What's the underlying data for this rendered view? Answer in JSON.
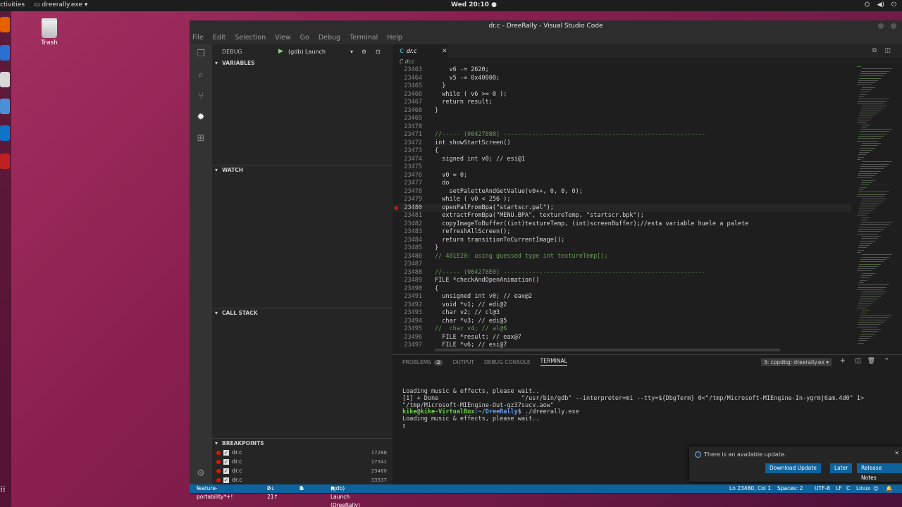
{
  "desktop": {
    "topbar": {
      "activities": "ctivities",
      "app_menu": "dreerally.exe",
      "clock": "Wed 20:10 ●"
    },
    "trash_label": "Trash"
  },
  "window": {
    "title": "dr.c - DreeRally - Visual Studio Code"
  },
  "menu": [
    "File",
    "Edit",
    "Selection",
    "View",
    "Go",
    "Debug",
    "Terminal",
    "Help"
  ],
  "debug": {
    "header": "DEBUG",
    "config": "(gdb) Launch",
    "sections": {
      "variables": "VARIABLES",
      "watch": "WATCH",
      "call_stack": "CALL STACK",
      "breakpoints": "BREAKPOINTS"
    },
    "breakpoints": [
      {
        "file": "dr.c",
        "line": "17288"
      },
      {
        "file": "dr.c",
        "line": "17341"
      },
      {
        "file": "dr.c",
        "line": "23480"
      },
      {
        "file": "dr.c",
        "line": "33537"
      }
    ]
  },
  "editor": {
    "tab": "dr.c",
    "tab_icon": "C",
    "breadcrumb": "C dr.c",
    "lines": [
      {
        "n": "23463",
        "t": "    v6 -= 2620;"
      },
      {
        "n": "23464",
        "t": "    v5 -= 0x40000;"
      },
      {
        "n": "23465",
        "t": "  }"
      },
      {
        "n": "23466",
        "t": "  while ( v6 >= 0 );"
      },
      {
        "n": "23467",
        "t": "  return result;"
      },
      {
        "n": "23468",
        "t": "}"
      },
      {
        "n": "23469",
        "t": ""
      },
      {
        "n": "23470",
        "t": ""
      },
      {
        "n": "23471",
        "t": "//----- (00427880) --------------------------------------------------------"
      },
      {
        "n": "23472",
        "t": "int showStartScreen()"
      },
      {
        "n": "23473",
        "t": "{"
      },
      {
        "n": "23474",
        "t": "  signed int v0; // esi@1"
      },
      {
        "n": "23475",
        "t": ""
      },
      {
        "n": "23476",
        "t": "  v0 = 0;"
      },
      {
        "n": "23477",
        "t": "  do"
      },
      {
        "n": "23478",
        "t": "    setPaletteAndGetValue(v0++, 0, 0, 0);"
      },
      {
        "n": "23479",
        "t": "  while ( v0 < 256 );"
      },
      {
        "n": "23480",
        "t": "  openPalFromBpa(\"startscr.pal\");"
      },
      {
        "n": "23481",
        "t": "  extractFromBpa(\"MENU.BPA\", textureTemp, \"startscr.bpk\");"
      },
      {
        "n": "23482",
        "t": "  copyImageToBuffer((int)textureTemp, (int)screenBuffer);//esta variable huele a palete"
      },
      {
        "n": "23483",
        "t": "  refreshAllScreen();"
      },
      {
        "n": "23484",
        "t": "  return transitionToCurrentImage();"
      },
      {
        "n": "23485",
        "t": "}"
      },
      {
        "n": "23486",
        "t": "// 481E20: using guessed type int textureTemp[];"
      },
      {
        "n": "23487",
        "t": ""
      },
      {
        "n": "23488",
        "t": "//----- (004278E0) --------------------------------------------------------"
      },
      {
        "n": "23489",
        "t": "FILE *checkAndOpenAnimation()"
      },
      {
        "n": "23490",
        "t": "{"
      },
      {
        "n": "23491",
        "t": "  unsigned int v0; // eax@2"
      },
      {
        "n": "23492",
        "t": "  void *v1; // edi@2"
      },
      {
        "n": "23493",
        "t": "  char v2; // cl@3"
      },
      {
        "n": "23494",
        "t": "  char *v3; // edi@5"
      },
      {
        "n": "23495",
        "t": "//  char v4; // al@6"
      },
      {
        "n": "23496",
        "t": "  FILE *result; // eax@7"
      },
      {
        "n": "23497",
        "t": "  FILE *v6; // esi@7"
      }
    ],
    "breakpoint_line": "23480"
  },
  "panel": {
    "tabs": [
      "PROBLEMS",
      "OUTPUT",
      "DEBUG CONSOLE",
      "TERMINAL"
    ],
    "problems_count": "2",
    "terminal_select": "3: cppdbg: dreerally.ex ▾",
    "terminal": {
      "l1": "Loading music & effects, please wait..",
      "l2": "[1] + Done                       \"/usr/bin/gdb\" --interpreter=mi --tty=${DbgTerm} 0<\"/tmp/Microsoft-MIEngine-In-ygrmj6am.4d0\" 1>",
      "l3": "\"/tmp/Microsoft-MIEngine-Out-qz37sucv.aow\"",
      "prompt_user": "kike@kike-VirtualBox",
      "prompt_path": ":~/DreeRally",
      "prompt_cmd": "$ ./dreerally.exe",
      "l5": "Loading music & effects, please wait.."
    }
  },
  "notification": {
    "message": "There is an available update.",
    "buttons": [
      "Download Update",
      "Later",
      "Release Notes"
    ]
  },
  "status": {
    "branch": "feature-portability*+!",
    "sync": "2↓ 21↑",
    "errors": "1",
    "warnings": "0",
    "debug": "(gdb) Launch (DreeRally)",
    "position": "Ln 23480, Col 1",
    "spaces": "Spaces: 2",
    "encoding": "UTF-8",
    "eol": "LF",
    "language": "C",
    "platform": "Linux"
  }
}
